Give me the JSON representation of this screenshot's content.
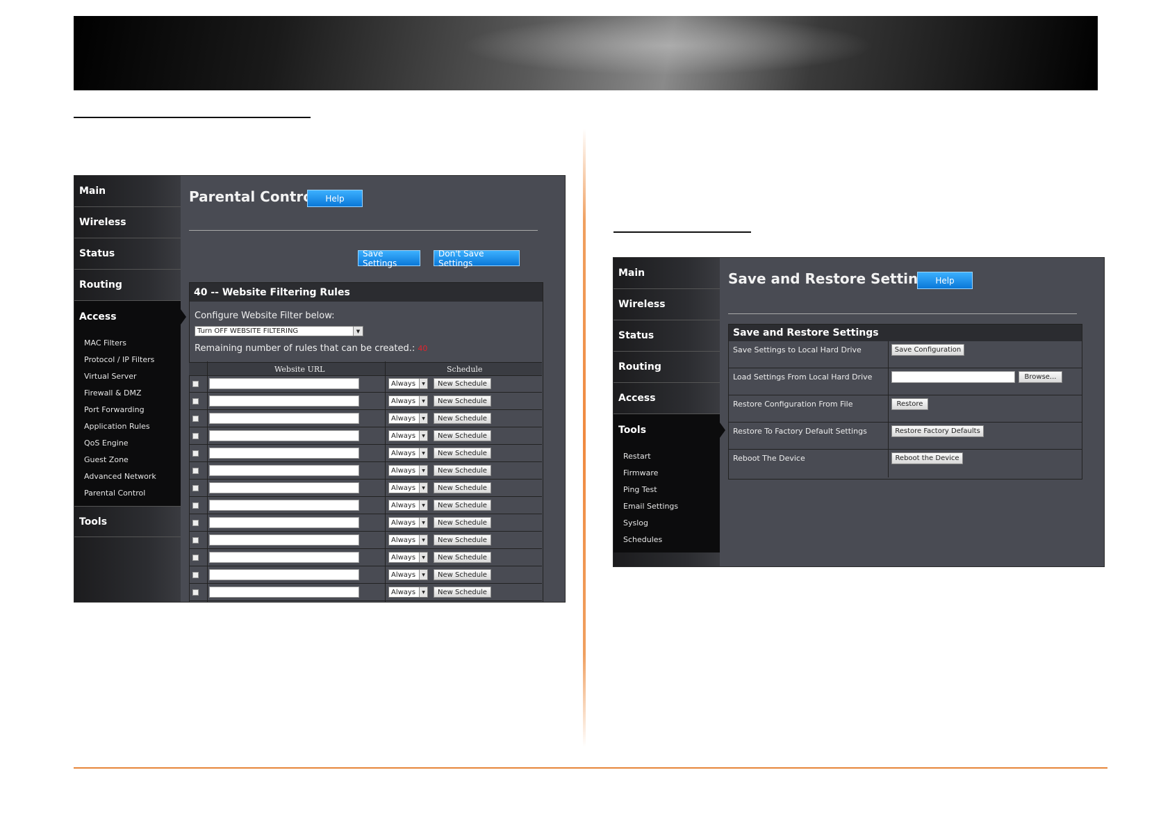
{
  "left": {
    "nav": {
      "items": [
        "Main",
        "Wireless",
        "Status",
        "Routing"
      ],
      "active": "Access",
      "subitems": [
        "MAC Filters",
        "Protocol / IP Filters",
        "Virtual Server",
        "Firewall & DMZ",
        "Port Forwarding",
        "Application Rules",
        "QoS Engine",
        "Guest Zone",
        "Advanced Network",
        "Parental Control"
      ],
      "after": "Tools"
    },
    "title": "Parental Control",
    "help": "Help",
    "save_settings": "Save Settings",
    "dont_save": "Don't Save Settings",
    "box_title": "40 -- Website Filtering Rules",
    "configure_label": "Configure Website Filter below:",
    "filter_select": "Turn OFF WEBSITE FILTERING",
    "remaining_label": "Remaining number of rules that can be created.:",
    "remaining_value": "40",
    "col_url": "Website URL",
    "col_schedule": "Schedule",
    "row_select": "Always",
    "row_button": "New Schedule",
    "row_count": 13
  },
  "right": {
    "nav": {
      "items": [
        "Main",
        "Wireless",
        "Status",
        "Routing",
        "Access"
      ],
      "active": "Tools",
      "subitems": [
        "Restart",
        "Firmware",
        "Ping Test",
        "Email Settings",
        "Syslog",
        "Schedules"
      ]
    },
    "title": "Save and Restore Settings",
    "help": "Help",
    "box_title": "Save and Restore Settings",
    "rows": [
      {
        "label": "Save Settings to Local Hard Drive",
        "button": "Save Configuration"
      },
      {
        "label": "Load Settings From Local Hard Drive",
        "button": "Browse..."
      },
      {
        "label": "Restore Configuration From File",
        "button": "Restore"
      },
      {
        "label": "Restore To Factory Default Settings",
        "button": "Restore Factory Defaults"
      },
      {
        "label": "Reboot The Device",
        "button": "Reboot the Device"
      }
    ]
  },
  "colors": {
    "accent_orange": "#e7863a",
    "help_blue": "#1a90f0",
    "panel_bg": "#494b53"
  }
}
